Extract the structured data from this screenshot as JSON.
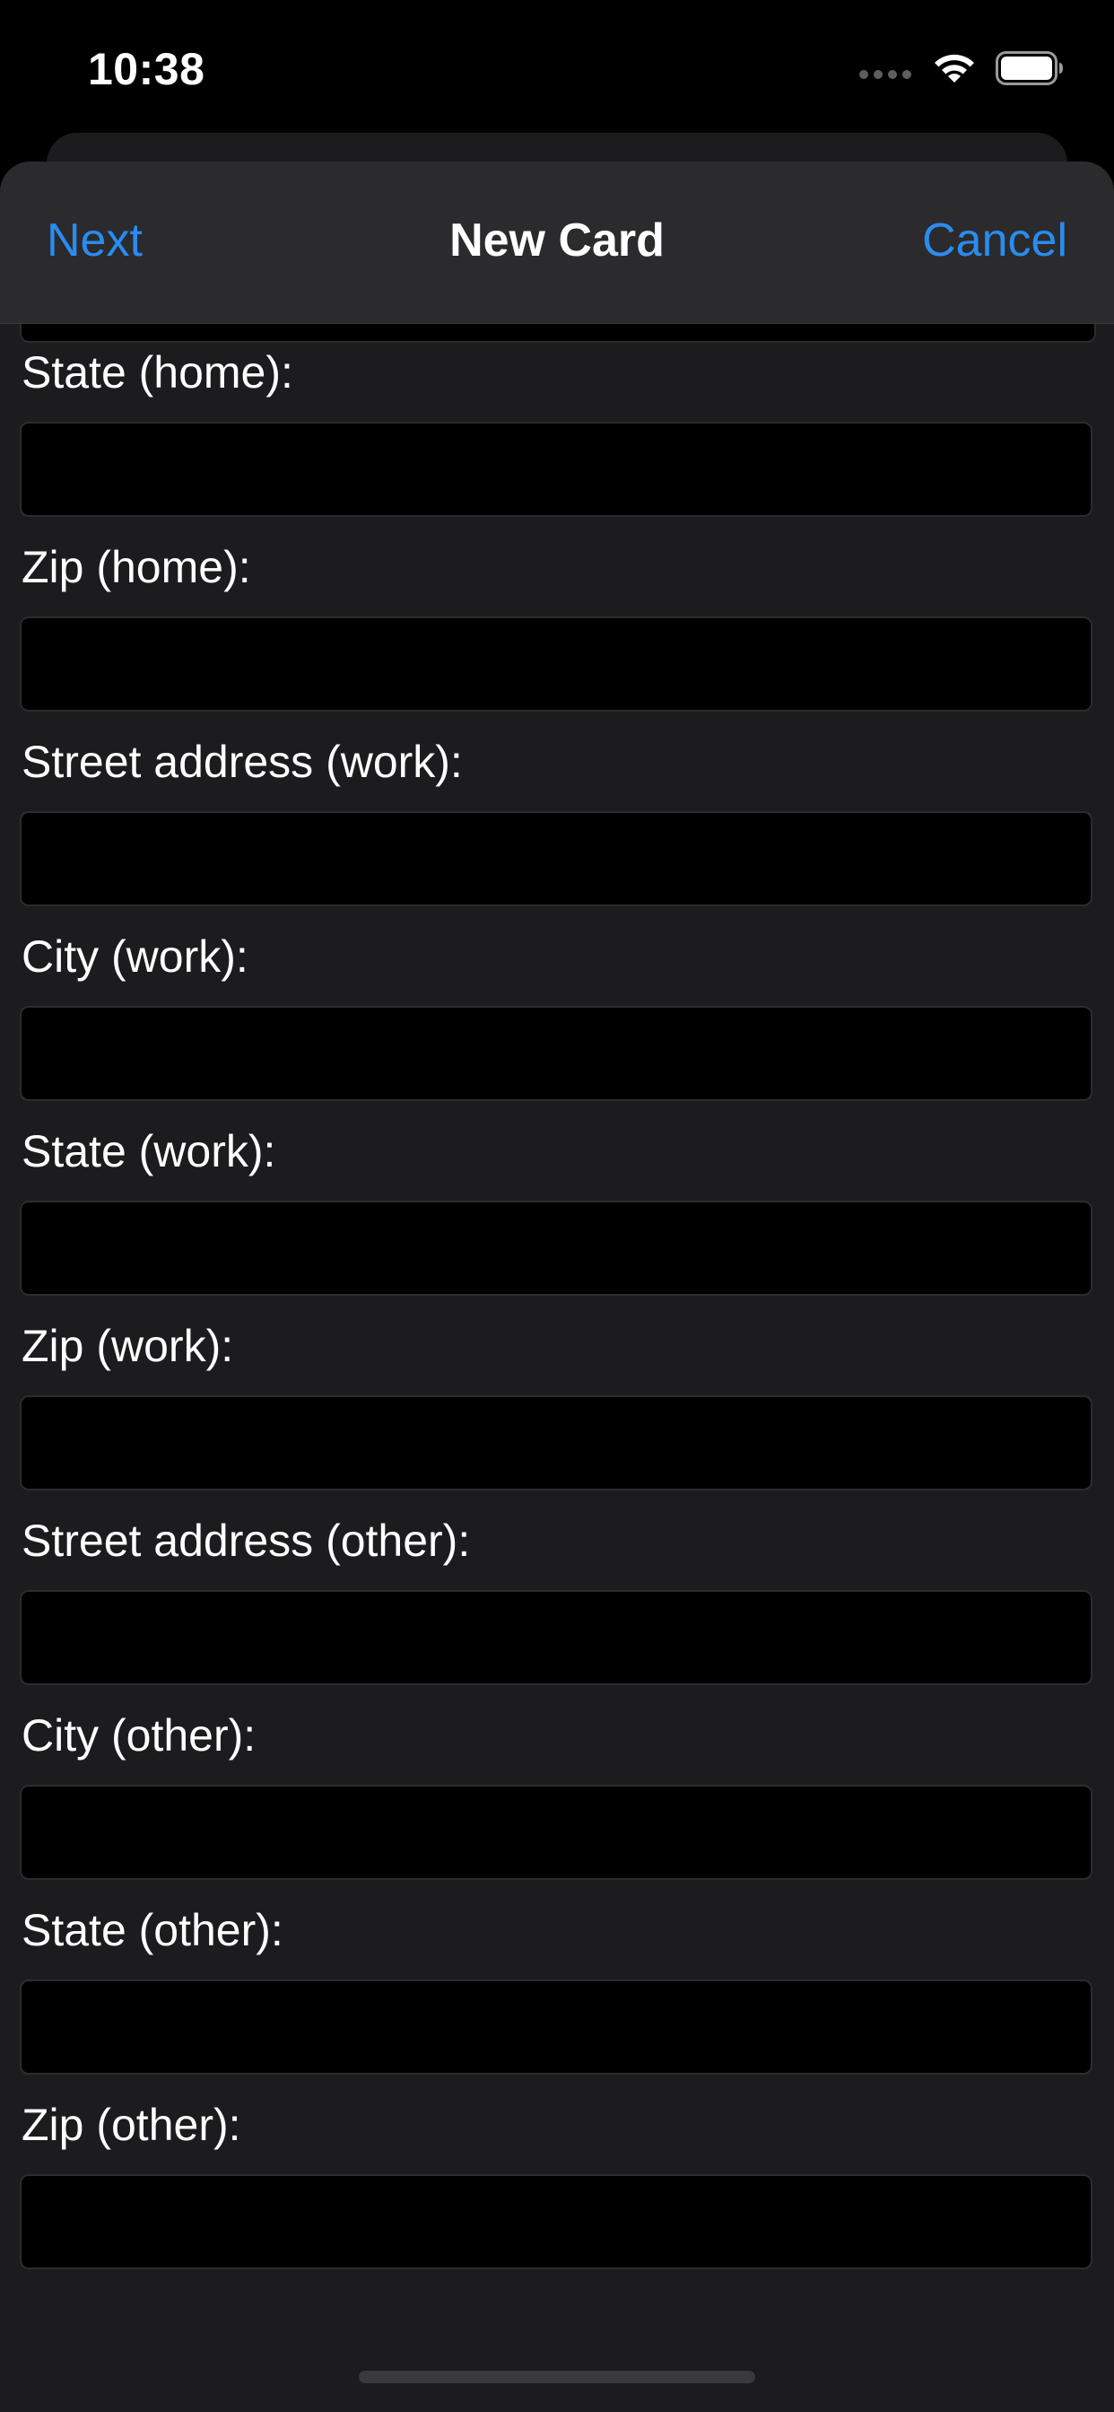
{
  "status_bar": {
    "time": "10:38"
  },
  "nav": {
    "left_label": "Next",
    "title": "New Card",
    "right_label": "Cancel"
  },
  "colors": {
    "accent": "#2a8cf0",
    "sheet_background": "#1c1c1e",
    "nav_background": "#2b2b2d",
    "field_background": "#000000"
  },
  "form": {
    "fields": [
      {
        "label": "State (home):",
        "value": ""
      },
      {
        "label": "Zip (home):",
        "value": ""
      },
      {
        "label": "Street address (work):",
        "value": ""
      },
      {
        "label": "City (work):",
        "value": ""
      },
      {
        "label": "State (work):",
        "value": ""
      },
      {
        "label": "Zip (work):",
        "value": ""
      },
      {
        "label": "Street address (other):",
        "value": ""
      },
      {
        "label": "City (other):",
        "value": ""
      },
      {
        "label": "State (other):",
        "value": ""
      },
      {
        "label": "Zip (other):",
        "value": ""
      }
    ]
  }
}
